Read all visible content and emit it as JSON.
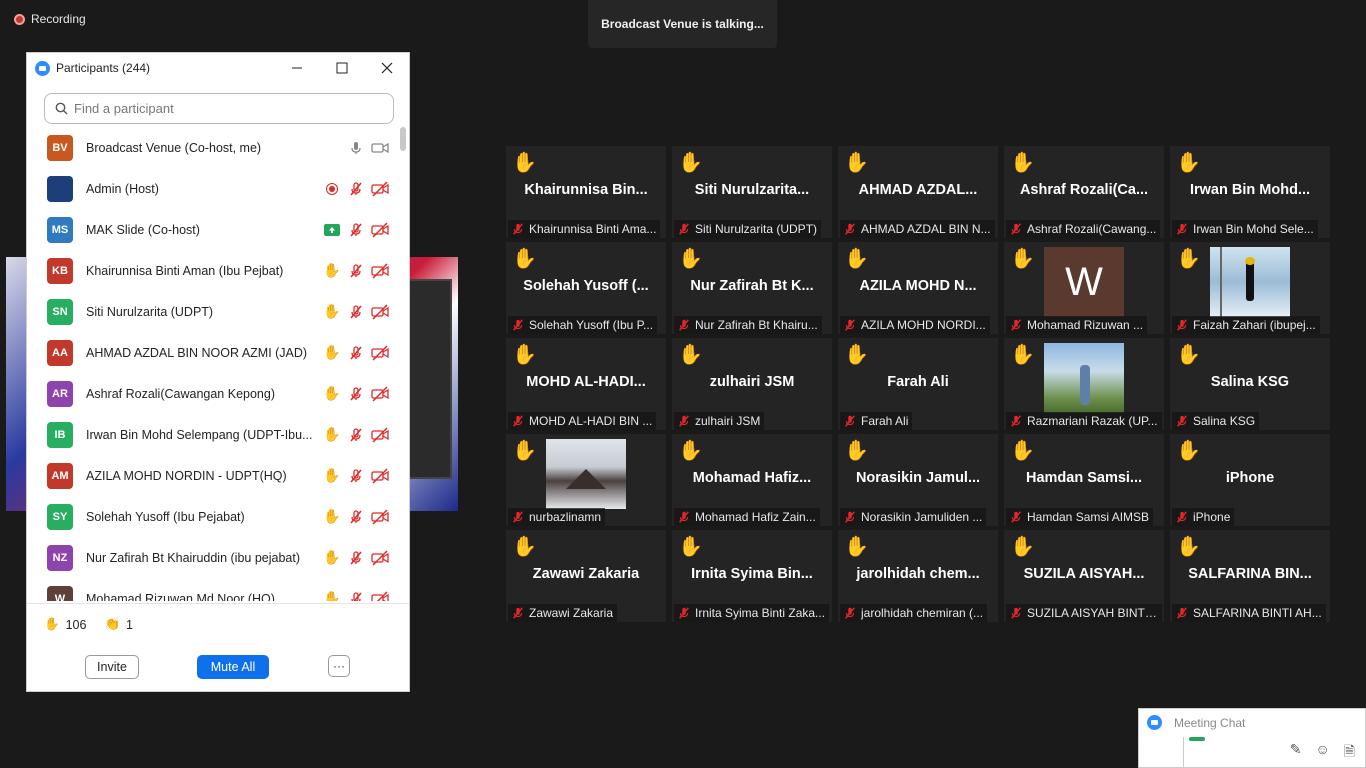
{
  "recording": {
    "label": "Recording"
  },
  "talking_banner": "Broadcast Venue is talking...",
  "participants_panel": {
    "title": "Participants (244)",
    "search_placeholder": "Find a participant",
    "participants": [
      {
        "initials": "BV",
        "name": "Broadcast Venue (Co-host, me)",
        "color": "#c8581e",
        "status": "mic-cam"
      },
      {
        "initials": "",
        "name": "Admin (Host)",
        "color": "#1c3f7a",
        "status": "rec-muted"
      },
      {
        "initials": "MS",
        "name": "MAK Slide (Co-host)",
        "color": "#2e7bbf",
        "status": "share-muted"
      },
      {
        "initials": "KB",
        "name": "Khairunnisa Binti Aman (Ibu Pejbat)",
        "color": "#c0392b",
        "status": "hand-muted"
      },
      {
        "initials": "SN",
        "name": "Siti Nurulzarita (UDPT)",
        "color": "#27ae60",
        "status": "hand-muted"
      },
      {
        "initials": "AA",
        "name": "AHMAD AZDAL BIN NOOR AZMI (JAD)",
        "color": "#c0392b",
        "status": "hand-muted"
      },
      {
        "initials": "AR",
        "name": "Ashraf Rozali(Cawangan Kepong)",
        "color": "#8e44ad",
        "status": "hand-muted"
      },
      {
        "initials": "IB",
        "name": "Irwan Bin Mohd Selempang (UDPT-Ibu...",
        "color": "#27ae60",
        "status": "hand-muted"
      },
      {
        "initials": "AM",
        "name": "AZILA MOHD NORDIN -  UDPT(HQ)",
        "color": "#c0392b",
        "status": "hand-muted"
      },
      {
        "initials": "SY",
        "name": "Solehah Yusoff (Ibu Pejabat)",
        "color": "#27ae60",
        "status": "hand-muted"
      },
      {
        "initials": "NZ",
        "name": "Nur Zafirah Bt Khairuddin (ibu pejabat)",
        "color": "#8e44ad",
        "status": "hand-muted"
      },
      {
        "initials": "W",
        "name": "Mohamad Rizuwan Md Noor (HQ)",
        "color": "#5d4037",
        "status": "hand-muted"
      }
    ],
    "reactions": [
      {
        "icon": "raised-hand",
        "count": "106"
      },
      {
        "icon": "clap",
        "count": "1"
      }
    ],
    "invite_label": "Invite",
    "mute_all_label": "Mute All",
    "more_label": "···"
  },
  "gallery": [
    {
      "display": "Khairunnisa  Bin...",
      "label": "Khairunnisa Binti Ama...",
      "image": ""
    },
    {
      "display": "Siti  Nurulzarita...",
      "label": "Siti Nurulzarita (UDPT)",
      "image": ""
    },
    {
      "display": "AHMAD  AZDAL...",
      "label": "AHMAD AZDAL BIN N...",
      "image": ""
    },
    {
      "display": "Ashraf  Rozali(Ca...",
      "label": "Ashraf Rozali(Cawang...",
      "image": ""
    },
    {
      "display": "Irwan  Bin  Mohd...",
      "label": "Irwan Bin Mohd Sele...",
      "image": ""
    },
    {
      "display": "Solehah  Yusoff  (...",
      "label": "Solehah Yusoff (Ibu P...",
      "image": ""
    },
    {
      "display": "Nur  Zafirah  Bt  K...",
      "label": "Nur Zafirah Bt Khairu...",
      "image": ""
    },
    {
      "display": "AZILA  MOHD  N...",
      "label": "AZILA MOHD NORDI...",
      "image": ""
    },
    {
      "display": "",
      "label": "Mohamad Rizuwan ...",
      "image": "letter-w",
      "letter": "W"
    },
    {
      "display": "",
      "label": "Faizah Zahari (ibupej...",
      "image": "photo-window"
    },
    {
      "display": "MOHD  AL-HADI...",
      "label": "MOHD AL-HADI BIN ...",
      "image": ""
    },
    {
      "display": "zulhairi  JSM",
      "label": "zulhairi JSM",
      "image": ""
    },
    {
      "display": "Farah Ali",
      "label": "Farah Ali",
      "image": ""
    },
    {
      "display": "",
      "label": "Razmariani Razak (UP...",
      "image": "photo-outdoor"
    },
    {
      "display": "Salina KSG",
      "label": "Salina KSG",
      "image": ""
    },
    {
      "display": "",
      "label": "nurbazlinamn",
      "image": "photo-snow"
    },
    {
      "display": "Mohamad  Hafiz...",
      "label": "Mohamad Hafiz Zain...",
      "image": ""
    },
    {
      "display": "Norasikin  Jamul...",
      "label": "Norasikin Jamuliden ...",
      "image": ""
    },
    {
      "display": "Hamdan  Samsi...",
      "label": "Hamdan Samsi AIMSB",
      "image": ""
    },
    {
      "display": "iPhone",
      "label": "iPhone",
      "image": ""
    },
    {
      "display": "Zawawi Zakaria",
      "label": "Zawawi Zakaria",
      "image": ""
    },
    {
      "display": "Irnita  Syima  Bin...",
      "label": "Irnita Syima Binti Zaka...",
      "image": ""
    },
    {
      "display": "jarolhidah  chem...",
      "label": "jarolhidah chemiran (...",
      "image": ""
    },
    {
      "display": "SUZILA  AISYAH...",
      "label": "SUZILA AISYAH BINTI ...",
      "image": ""
    },
    {
      "display": "SALFARINA  BIN...",
      "label": "SALFARINA BINTI AH...",
      "image": ""
    }
  ],
  "meeting_chat": {
    "title": "Meeting Chat"
  },
  "colors": {
    "accent": "#0e71eb",
    "hand": "#f6c22e",
    "muted_red": "#e02828"
  }
}
